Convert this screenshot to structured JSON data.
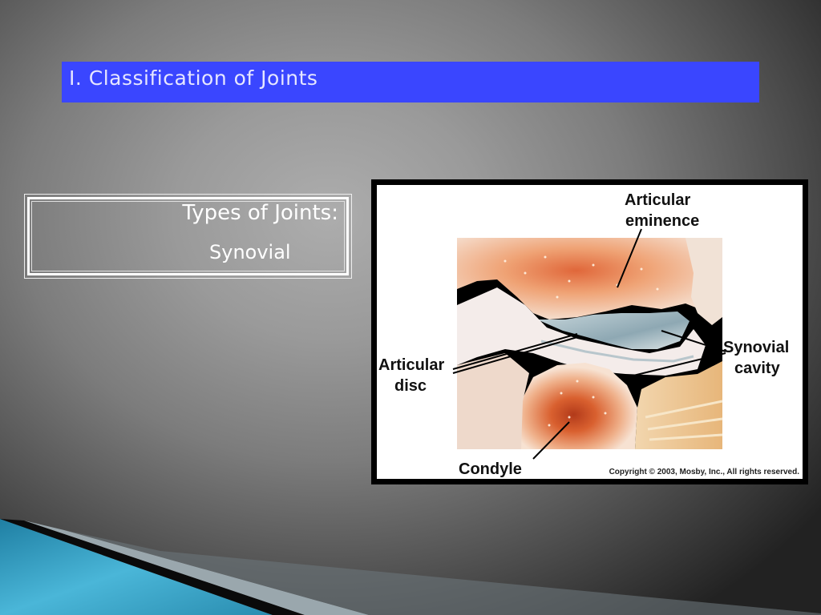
{
  "slide": {
    "title": "I. Classification of Joints",
    "title_bar_color": "#3a46ff"
  },
  "types_box": {
    "heading": "Types of Joints:",
    "item": "Synovial"
  },
  "figure": {
    "labels": {
      "articular_eminence_line1": "Articular",
      "articular_eminence_line2": "eminence",
      "articular_disc_line1": "Articular",
      "articular_disc_line2": "disc",
      "synovial_cavity_line1": "Synovial",
      "synovial_cavity_line2": "cavity",
      "condyle": "Condyle"
    },
    "copyright": "Copyright © 2003, Mosby, Inc., All rights reserved."
  },
  "decoration": {
    "accent_color": "#3aa6c8"
  }
}
